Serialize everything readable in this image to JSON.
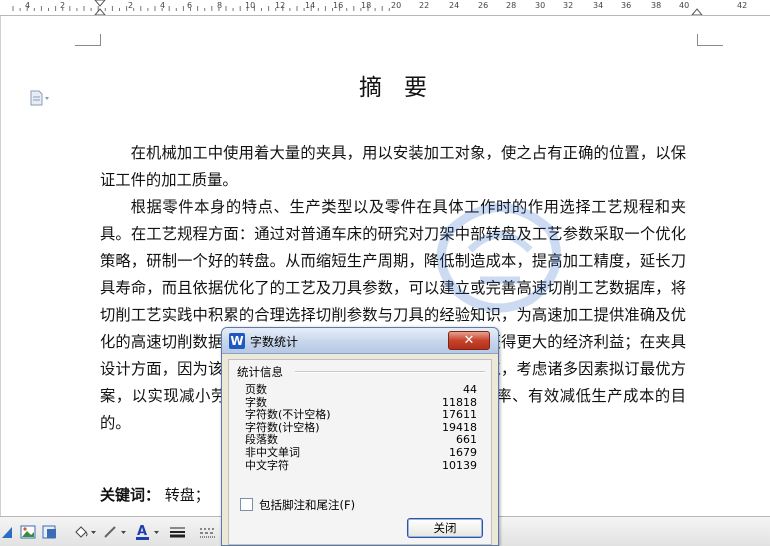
{
  "ruler": {
    "numbers": [
      "4",
      "2",
      "2",
      "4",
      "6",
      "8",
      "10",
      "12",
      "14",
      "16",
      "18",
      "20",
      "22",
      "24",
      "26",
      "28",
      "30",
      "32",
      "34",
      "36",
      "38",
      "40",
      "42"
    ]
  },
  "document": {
    "title": "摘要",
    "paragraphs": [
      "在机械加工中使用着大量的夹具，用以安装加工对象，使之占有正确的位置，以保证工件的加工质量。",
      "根据零件本身的特点、生产类型以及零件在具体工作时的作用选择工艺规程和夹具。在工艺规程方面：通过对普通车床的研究对刀架中部转盘及工艺参数采取一个优化策略，研制一个好的转盘。从而缩短生产周期，降低制造成本，提高加工精度，延长刀具寿命，而且依据优化了的工艺及刀具参数，可以建立或完善高速切削工艺数据库，将切削工艺实践中积累的合理选择切削参数与刀具的经验知识，为高速加工提供准确及优化的高速切削数据，从而更好地发挥高速切削的优越性，获得更大的经济利益；在夹具设计方面，因为该零件为小批量生产，故选用立式铣床加工，考虑诸多因素拟订最优方案，以实现减小劳动强度，缩短辅助时间、提高劳动生产率、有效减低生产成本的目的。"
    ],
    "keywords_label": "关键词：",
    "keywords_value": "转盘；"
  },
  "dialog": {
    "title": "字数统计",
    "close_glyph": "✕",
    "logo_glyph": "W",
    "group_label": "统计信息",
    "stats": [
      {
        "label": "页数",
        "value": "44"
      },
      {
        "label": "字数",
        "value": "11818"
      },
      {
        "label": "字符数(不计空格)",
        "value": "17611"
      },
      {
        "label": "字符数(计空格)",
        "value": "19418"
      },
      {
        "label": "段落数",
        "value": "661"
      },
      {
        "label": "非中文单词",
        "value": "1679"
      },
      {
        "label": "中文字符",
        "value": "10139"
      }
    ],
    "checkbox_label": "包括脚注和尾注(F)",
    "close_button": "关闭"
  },
  "colors": {
    "dialog_bg": "#ece9d8",
    "title_close": "#c7422b",
    "button_border": "#2d54a3",
    "font_color_bar": "#1f3fb0"
  }
}
